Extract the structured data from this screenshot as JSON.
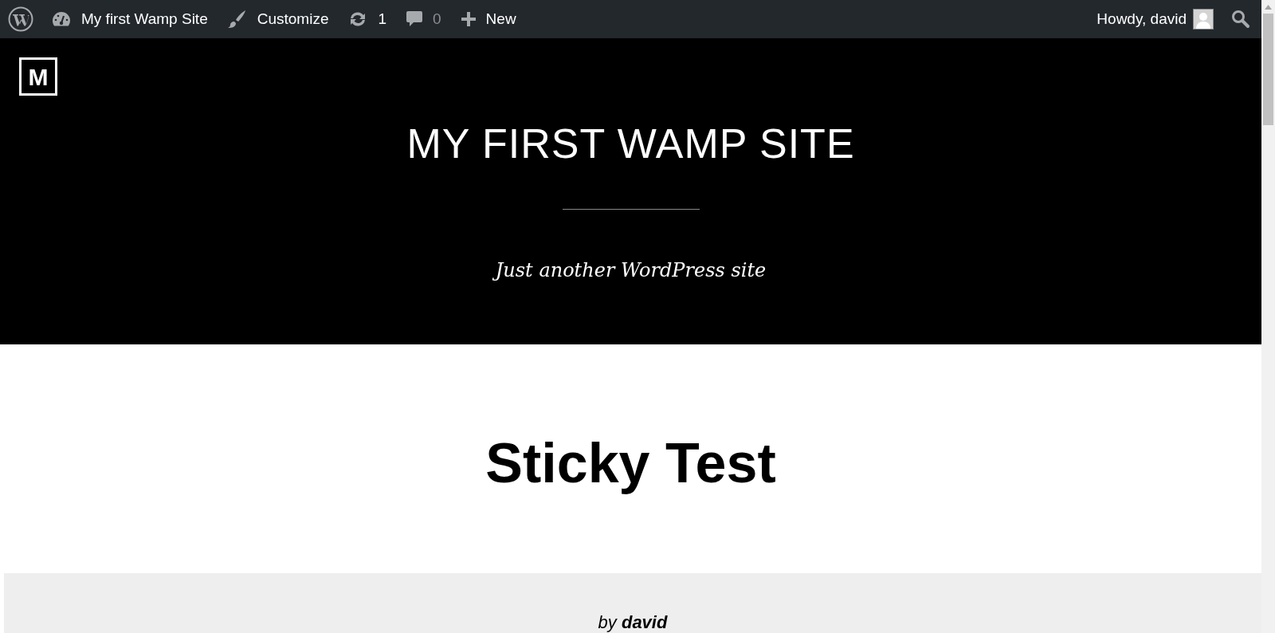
{
  "admin_bar": {
    "items": [
      {
        "kind": "site",
        "label": "My first Wamp Site"
      },
      {
        "kind": "customize",
        "label": "Customize"
      },
      {
        "kind": "updates",
        "label": "1"
      },
      {
        "kind": "comments",
        "label": "0"
      },
      {
        "kind": "new",
        "label": "New"
      }
    ],
    "greeting": "Howdy, david"
  },
  "header": {
    "logo": "M",
    "site_title": "MY FIRST WAMP SITE",
    "tagline": "Just another WordPress site"
  },
  "post": {
    "title": "Sticky Test",
    "byline": "by **david**"
  }
}
